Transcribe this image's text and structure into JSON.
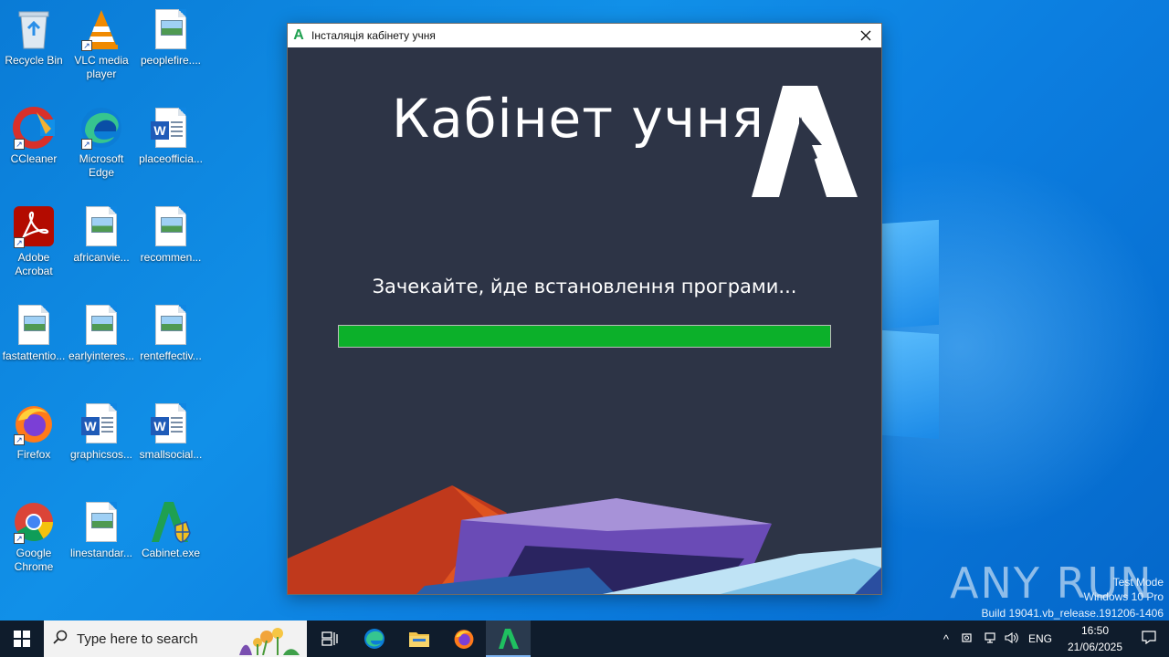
{
  "desktop": {
    "icons": [
      {
        "label": "Recycle Bin",
        "icon": "recycle-bin-icon"
      },
      {
        "label": "VLC media player",
        "icon": "vlc-icon"
      },
      {
        "label": "peoplefire....",
        "icon": "image-file-icon"
      },
      {
        "label": "CCleaner",
        "icon": "ccleaner-icon"
      },
      {
        "label": "Microsoft Edge",
        "icon": "edge-icon"
      },
      {
        "label": "placeofficia...",
        "icon": "word-doc-icon"
      },
      {
        "label": "Adobe Acrobat",
        "icon": "acrobat-icon"
      },
      {
        "label": "africanvie...",
        "icon": "image-file-icon"
      },
      {
        "label": "recommen...",
        "icon": "image-file-icon"
      },
      {
        "label": "fastattentio...",
        "icon": "image-file-icon"
      },
      {
        "label": "earlyinteres...",
        "icon": "image-file-icon"
      },
      {
        "label": "renteffectiv...",
        "icon": "image-file-icon"
      },
      {
        "label": "Firefox",
        "icon": "firefox-icon"
      },
      {
        "label": "graphicsos...",
        "icon": "word-doc-icon"
      },
      {
        "label": "smallsocial...",
        "icon": "word-doc-icon"
      },
      {
        "label": "Google Chrome",
        "icon": "chrome-icon"
      },
      {
        "label": "linestandar...",
        "icon": "image-file-icon"
      },
      {
        "label": "Cabinet.exe",
        "icon": "cabinet-exe-icon"
      }
    ]
  },
  "installer": {
    "title": "Інсталяція кабінету учня",
    "hero_title": "Кабінет учня",
    "status": "Зачекайте, йде встановлення програми...",
    "progress": 1.0,
    "progress_color": "#0cb02a",
    "background_color": "#2d3446"
  },
  "watermark": {
    "brand": "ANY RUN",
    "line1": "Test Mode",
    "line2": "Windows 10 Pro",
    "line3": "Build 19041.vb_release.191206-1406"
  },
  "taskbar": {
    "search_placeholder": "Type here to search",
    "apps": [
      "task-view-icon",
      "edge-icon",
      "file-explorer-icon",
      "firefox-icon",
      "cabinet-app-icon"
    ],
    "language": "ENG",
    "time": "16:50",
    "date": "21/06/2025"
  }
}
